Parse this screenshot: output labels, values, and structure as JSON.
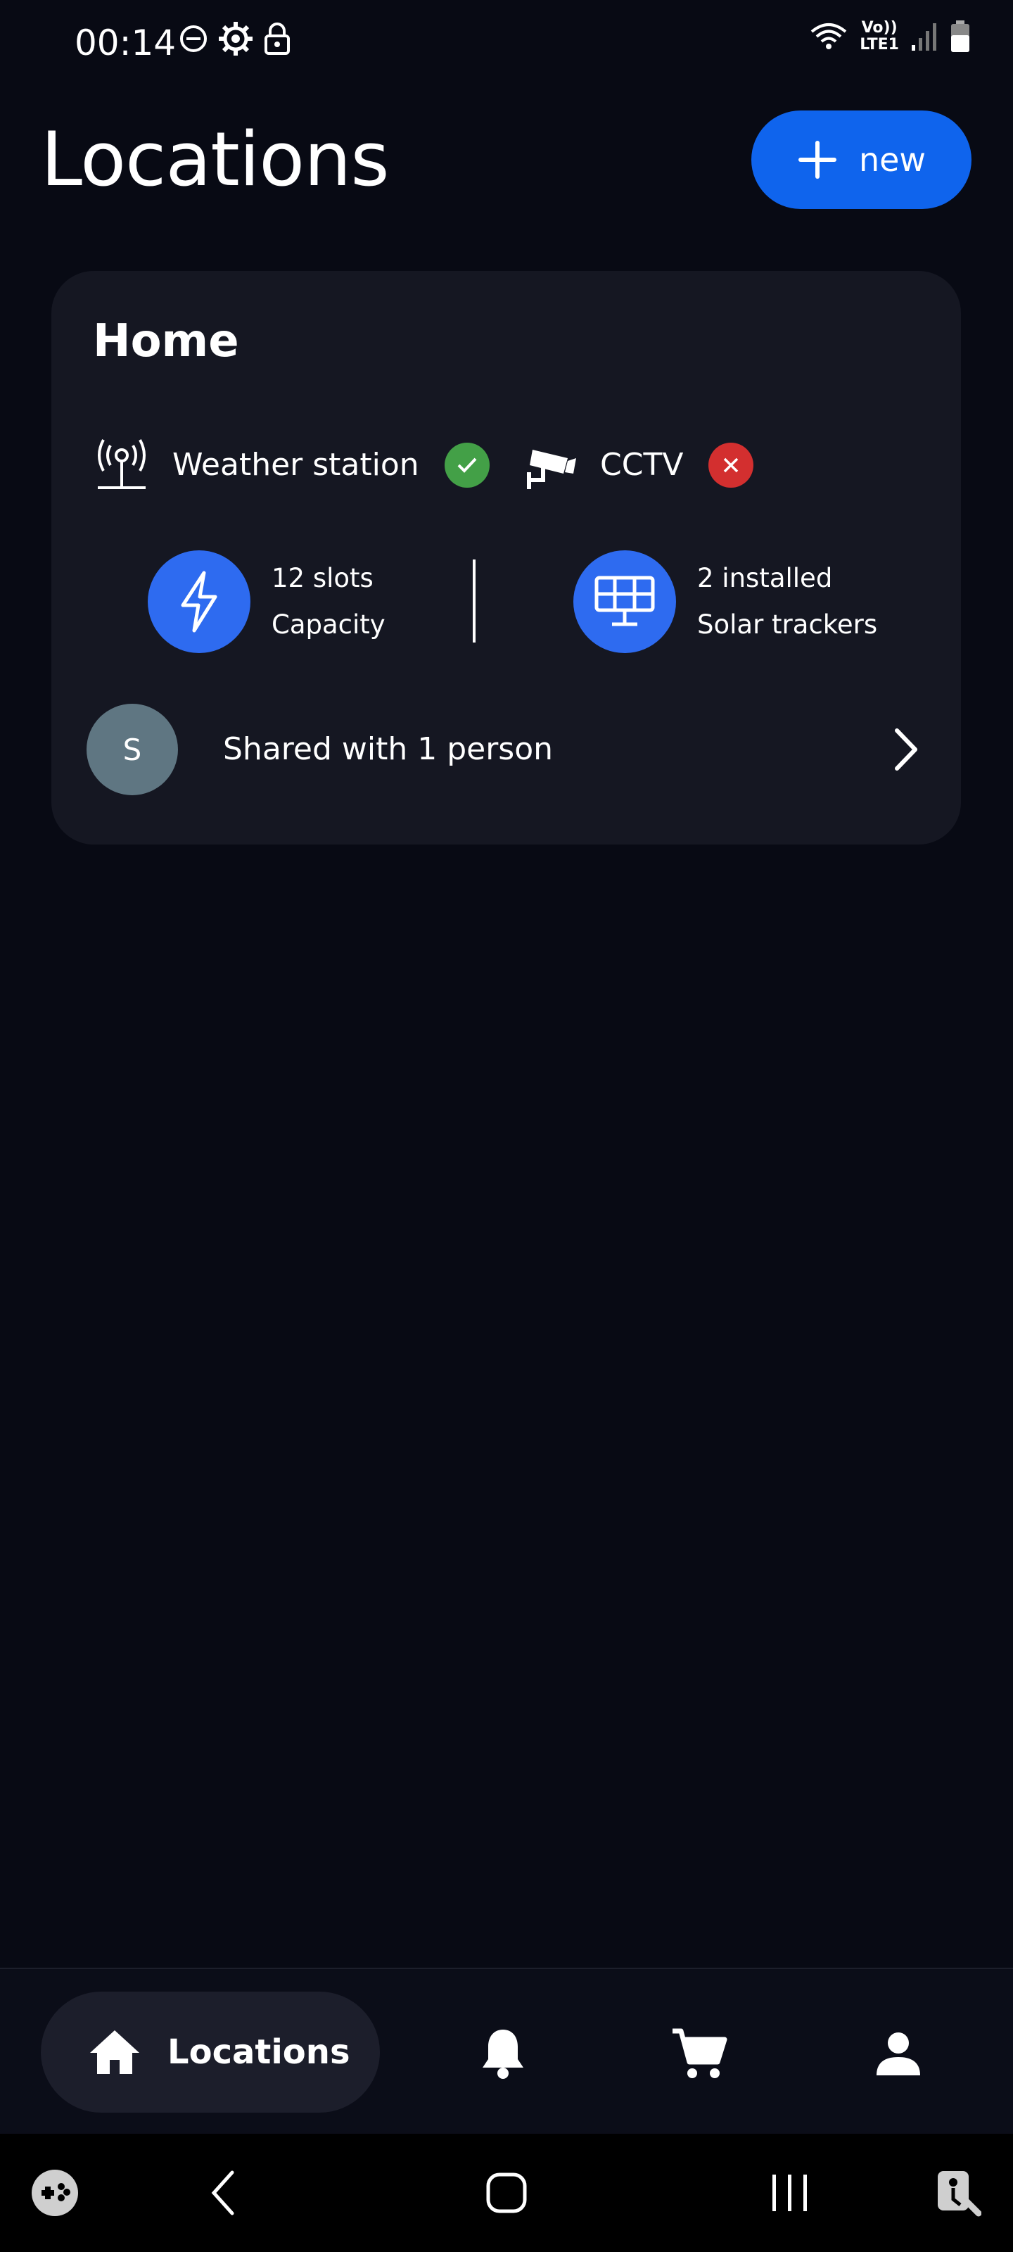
{
  "status_bar": {
    "time": "00:14",
    "volte": "Vo))",
    "lte": "LTE1",
    "icons": [
      "dnd-icon",
      "settings-gear-icon",
      "lock-icon",
      "wifi-icon",
      "signal-icon",
      "battery-icon"
    ]
  },
  "header": {
    "title": "Locations",
    "new_button_label": "new"
  },
  "location_card": {
    "title": "Home",
    "devices": [
      {
        "label": "Weather station",
        "icon": "weather-station-icon",
        "status": "ok"
      },
      {
        "label": "CCTV",
        "icon": "cctv-camera-icon",
        "status": "error"
      }
    ],
    "stats": [
      {
        "value": "12 slots",
        "label": "Capacity",
        "icon": "lightning-icon"
      },
      {
        "value": "2 installed",
        "label": "Solar trackers",
        "icon": "solar-panel-icon"
      }
    ],
    "shared": {
      "avatar_initial": "S",
      "text": "Shared with 1 person"
    }
  },
  "bottom_nav": {
    "active_label": "Locations",
    "items": [
      "home-icon",
      "bell-icon",
      "cart-icon",
      "person-icon"
    ]
  },
  "colors": {
    "background": "#080a14",
    "card": "#151722",
    "accent": "#0f64ed",
    "stat_circle": "#2e6bf0",
    "ok": "#43a047",
    "error": "#d32f2f",
    "avatar": "#5f7682"
  }
}
